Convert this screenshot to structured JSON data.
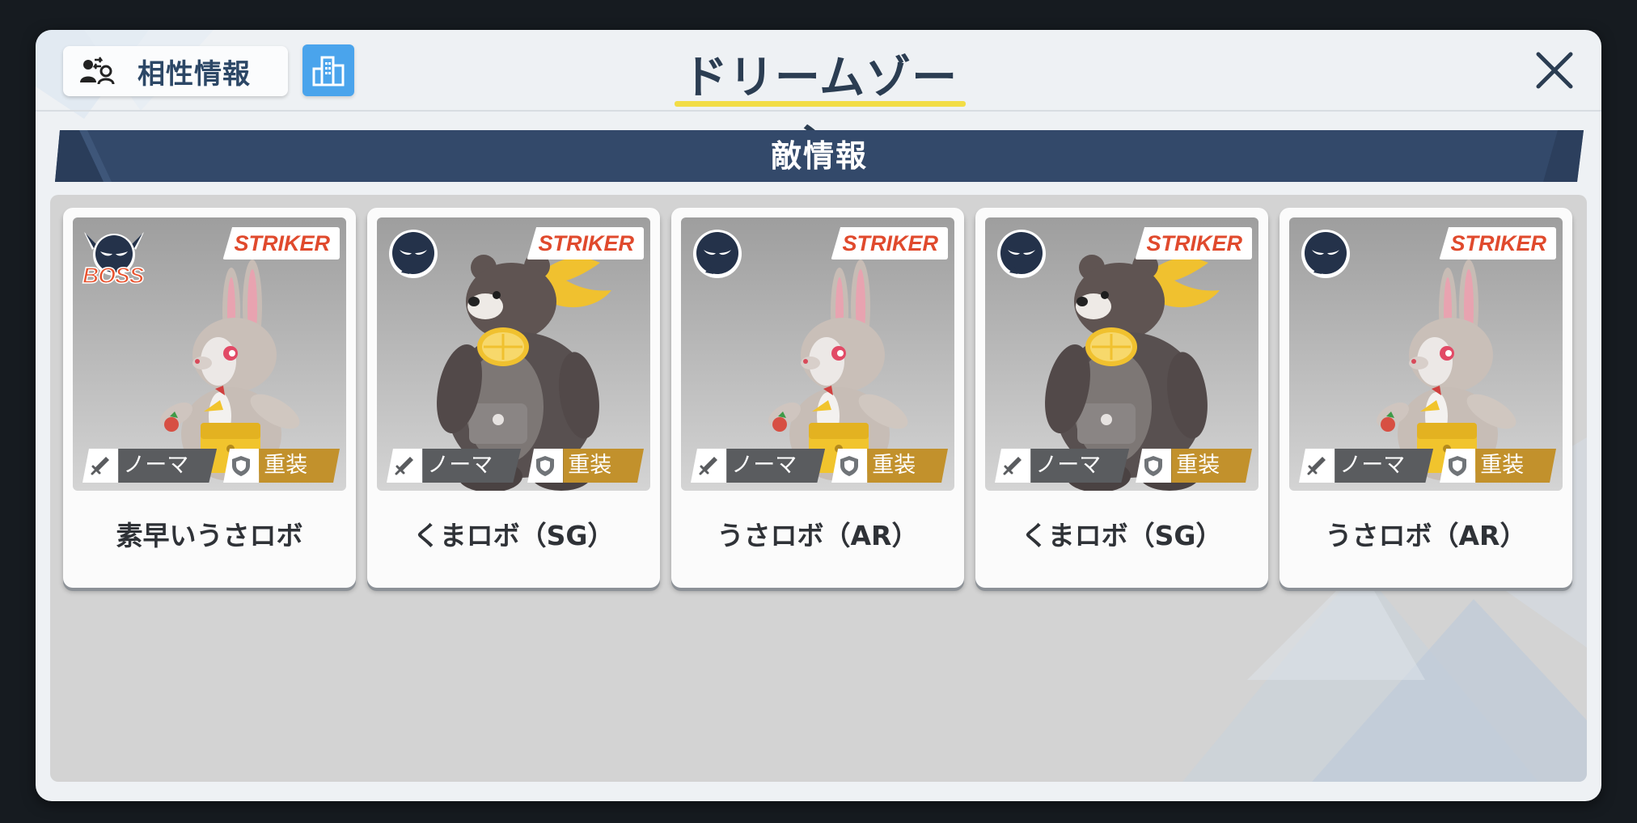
{
  "header": {
    "affinity_label": "相性情報",
    "title": "ドリームゾーン",
    "affinity_icon": "affinity-icon",
    "building_icon": "building-icon",
    "close_icon": "close-icon"
  },
  "section": {
    "title": "敵情報"
  },
  "colors": {
    "accent_blue": "#4aa4ec",
    "section_bar": "#33496a",
    "title_underline": "#f2dd46",
    "striker_text": "#e04a2d",
    "armor_tag": "#c2912c",
    "attack_tag": "#5a5c5f"
  },
  "enemies": [
    {
      "name": "素早いうさロボ",
      "role": "STRIKER",
      "attack": "ノーマル",
      "armor": "重装甲",
      "boss": true,
      "boss_label": "BOSS",
      "character": "rabbit"
    },
    {
      "name": "くまロボ（SG）",
      "role": "STRIKER",
      "attack": "ノーマル",
      "armor": "重装甲",
      "boss": false,
      "character": "bear"
    },
    {
      "name": "うさロボ（AR）",
      "role": "STRIKER",
      "attack": "ノーマル",
      "armor": "重装甲",
      "boss": false,
      "character": "rabbit"
    },
    {
      "name": "くまロボ（SG）",
      "role": "STRIKER",
      "attack": "ノーマル",
      "armor": "重装甲",
      "boss": false,
      "character": "bear"
    },
    {
      "name": "うさロボ（AR）",
      "role": "STRIKER",
      "attack": "ノーマル",
      "armor": "重装甲",
      "boss": false,
      "character": "rabbit"
    }
  ]
}
